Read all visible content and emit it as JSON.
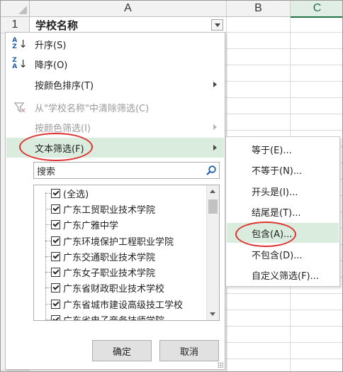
{
  "sheet": {
    "columns": [
      "A",
      "B",
      "C"
    ],
    "row_number": "1",
    "cell_a1": "学校名称"
  },
  "menu": {
    "sort_asc": "升序(S)",
    "sort_desc": "降序(O)",
    "sort_by_color": "按颜色排序(T)",
    "clear_filter": "从\"学校名称\"中清除筛选(C)",
    "filter_by_color": "按颜色筛选(I)",
    "text_filter": "文本筛选(F)"
  },
  "search": {
    "placeholder": "搜索"
  },
  "list_items": [
    "(全选)",
    "广东工贸职业技术学院",
    "广东广雅中学",
    "广东环境保护工程职业学院",
    "广东交通职业技术学院",
    "广东女子职业技术学院",
    "广东省财政职业技术学校",
    "广东省城市建设高级技工学校",
    "广东省电子商务技师学院"
  ],
  "buttons": {
    "ok": "确定",
    "cancel": "取消"
  },
  "submenu": [
    "等于(E)...",
    "不等于(N)...",
    "开头是(I)...",
    "结尾是(T)...",
    "包含(A)...",
    "不包含(D)...",
    "自定义筛选(F)..."
  ],
  "colors": {
    "highlight": "#d9ecdd",
    "annotation_ring": "#e03030",
    "active_column": "#217346"
  }
}
